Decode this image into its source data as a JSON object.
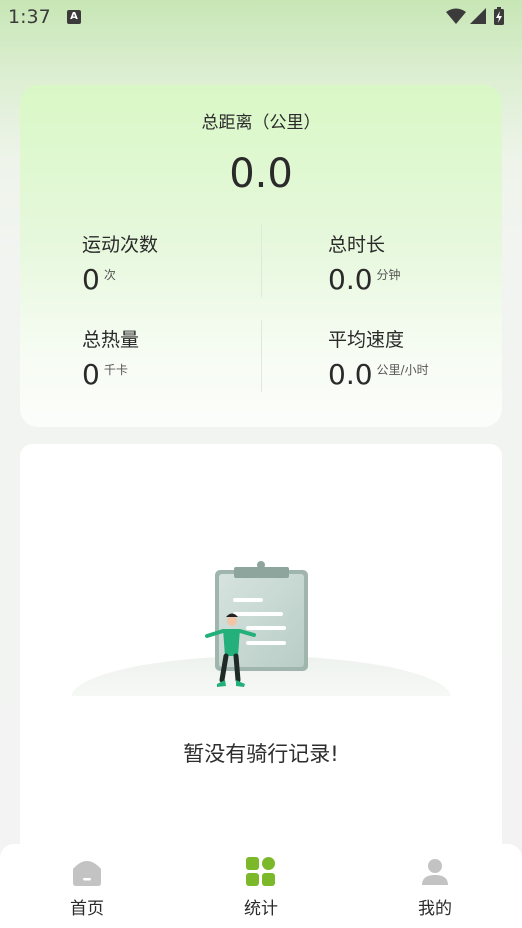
{
  "status_bar": {
    "time": "1:37",
    "notif_letter": "A"
  },
  "summary": {
    "total_distance_label": "总距离（公里）",
    "total_distance_value": "0.0",
    "stats": [
      {
        "label": "运动次数",
        "value": "0",
        "unit": "次"
      },
      {
        "label": "总时长",
        "value": "0.0",
        "unit": "分钟"
      },
      {
        "label": "总热量",
        "value": "0",
        "unit": "千卡"
      },
      {
        "label": "平均速度",
        "value": "0.0",
        "unit": "公里/小时"
      }
    ]
  },
  "empty_state": {
    "message": "暂没有骑行记录!"
  },
  "bottom_nav": {
    "items": [
      {
        "label": "首页",
        "icon": "home-icon",
        "active": false
      },
      {
        "label": "统计",
        "icon": "grid-icon",
        "active": true
      },
      {
        "label": "我的",
        "icon": "person-icon",
        "active": false
      }
    ]
  },
  "colors": {
    "accent": "#7bb82a",
    "inactive_icon": "#c3c3c3"
  }
}
